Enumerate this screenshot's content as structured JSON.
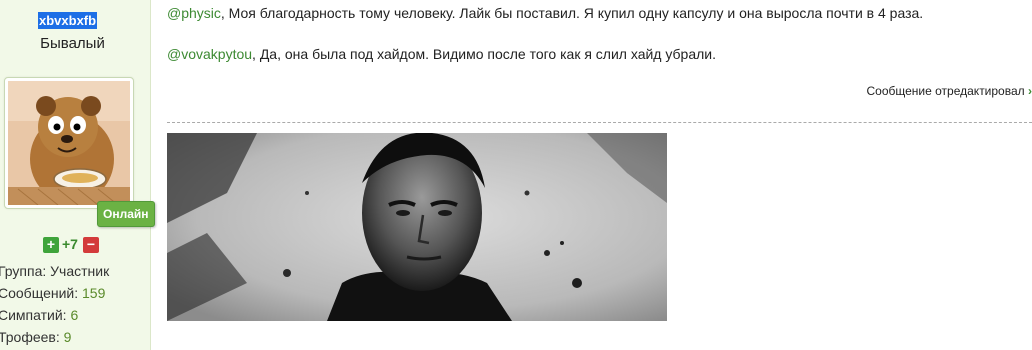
{
  "user": {
    "username": "xbvxbxfb",
    "title": "Бывалый",
    "status": "Онлайн",
    "reputation": "+7",
    "stats": [
      {
        "label": "Группа:",
        "value": "Участник"
      },
      {
        "label": "Сообщений:",
        "value": "159"
      },
      {
        "label": "Симпатий:",
        "value": "6"
      },
      {
        "label": "Трофеев:",
        "value": "9"
      }
    ]
  },
  "post": {
    "line1": {
      "mention": "@physic",
      "text": ", Моя благодарность тому человеку. Лайк бы поставил. Я купил одну капсулу и она выросла почти в 4 раза."
    },
    "line2": {
      "mention": "@vovakpytou",
      "text": ", Да, она была под хайдом. Видимо после того как я слил хайд убрали."
    },
    "edited_label": "Сообщение отредактировал",
    "edited_chevron": "›"
  },
  "colors": {
    "sidebar_bg": "#f2f9e8",
    "accent_green": "#3d8a33",
    "online_badge": "#6bb244",
    "selection_blue": "#1d6fe6"
  },
  "icons": {
    "rep_plus": "plus-icon",
    "rep_minus": "minus-icon",
    "edited": "chevron-right-icon"
  }
}
